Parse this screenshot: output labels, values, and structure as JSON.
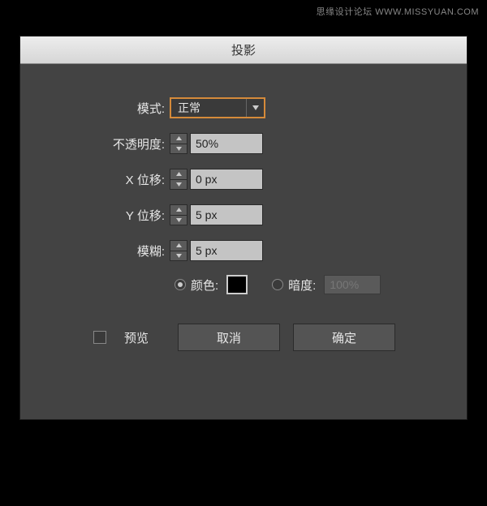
{
  "watermark": "思缘设计论坛  WWW.MISSYUAN.COM",
  "dialog": {
    "title": "投影",
    "fields": {
      "mode_label": "模式:",
      "mode_value": "正常",
      "opacity_label": "不透明度:",
      "opacity_value": "50%",
      "x_offset_label": "X 位移:",
      "x_offset_value": "0 px",
      "y_offset_label": "Y 位移:",
      "y_offset_value": "5 px",
      "blur_label": "模糊:",
      "blur_value": "5 px"
    },
    "color_option": {
      "color_label": "颜色:",
      "color_value": "#000000",
      "darkness_label": "暗度:",
      "darkness_value": "100%"
    },
    "preview_label": "预览",
    "buttons": {
      "cancel": "取消",
      "ok": "确定"
    }
  }
}
